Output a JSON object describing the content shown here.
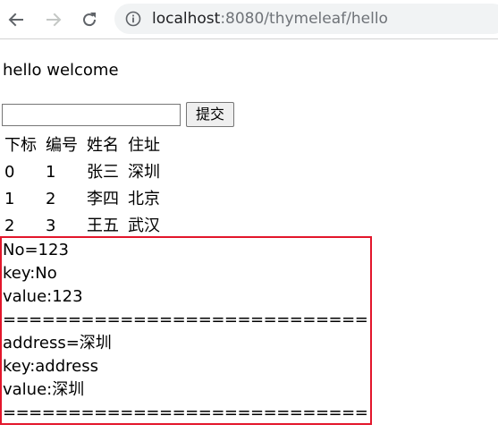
{
  "browser": {
    "url_host": "localhost",
    "url_path": ":8080/thymeleaf/hello",
    "back_icon": "arrow-left",
    "forward_icon": "arrow-right",
    "reload_icon": "reload",
    "info_icon": "info-circle"
  },
  "page": {
    "greeting": "hello welcome",
    "form": {
      "input_value": "",
      "submit_label": "提交"
    },
    "table": {
      "headers": [
        "下标",
        "编号",
        "姓名",
        "住址"
      ],
      "rows": [
        [
          "0",
          "1",
          "张三",
          "深圳"
        ],
        [
          "1",
          "2",
          "李四",
          "北京"
        ],
        [
          "2",
          "3",
          "王五",
          "武汉"
        ]
      ]
    },
    "map_block": {
      "border_color": "#e3162b",
      "entries": [
        {
          "pair": "No=123",
          "key_line": "key:No",
          "value_line": "value:123",
          "separator": "============================"
        },
        {
          "pair": "address=深圳",
          "key_line": "key:address",
          "value_line": "value:深圳",
          "separator": "============================"
        }
      ]
    }
  }
}
